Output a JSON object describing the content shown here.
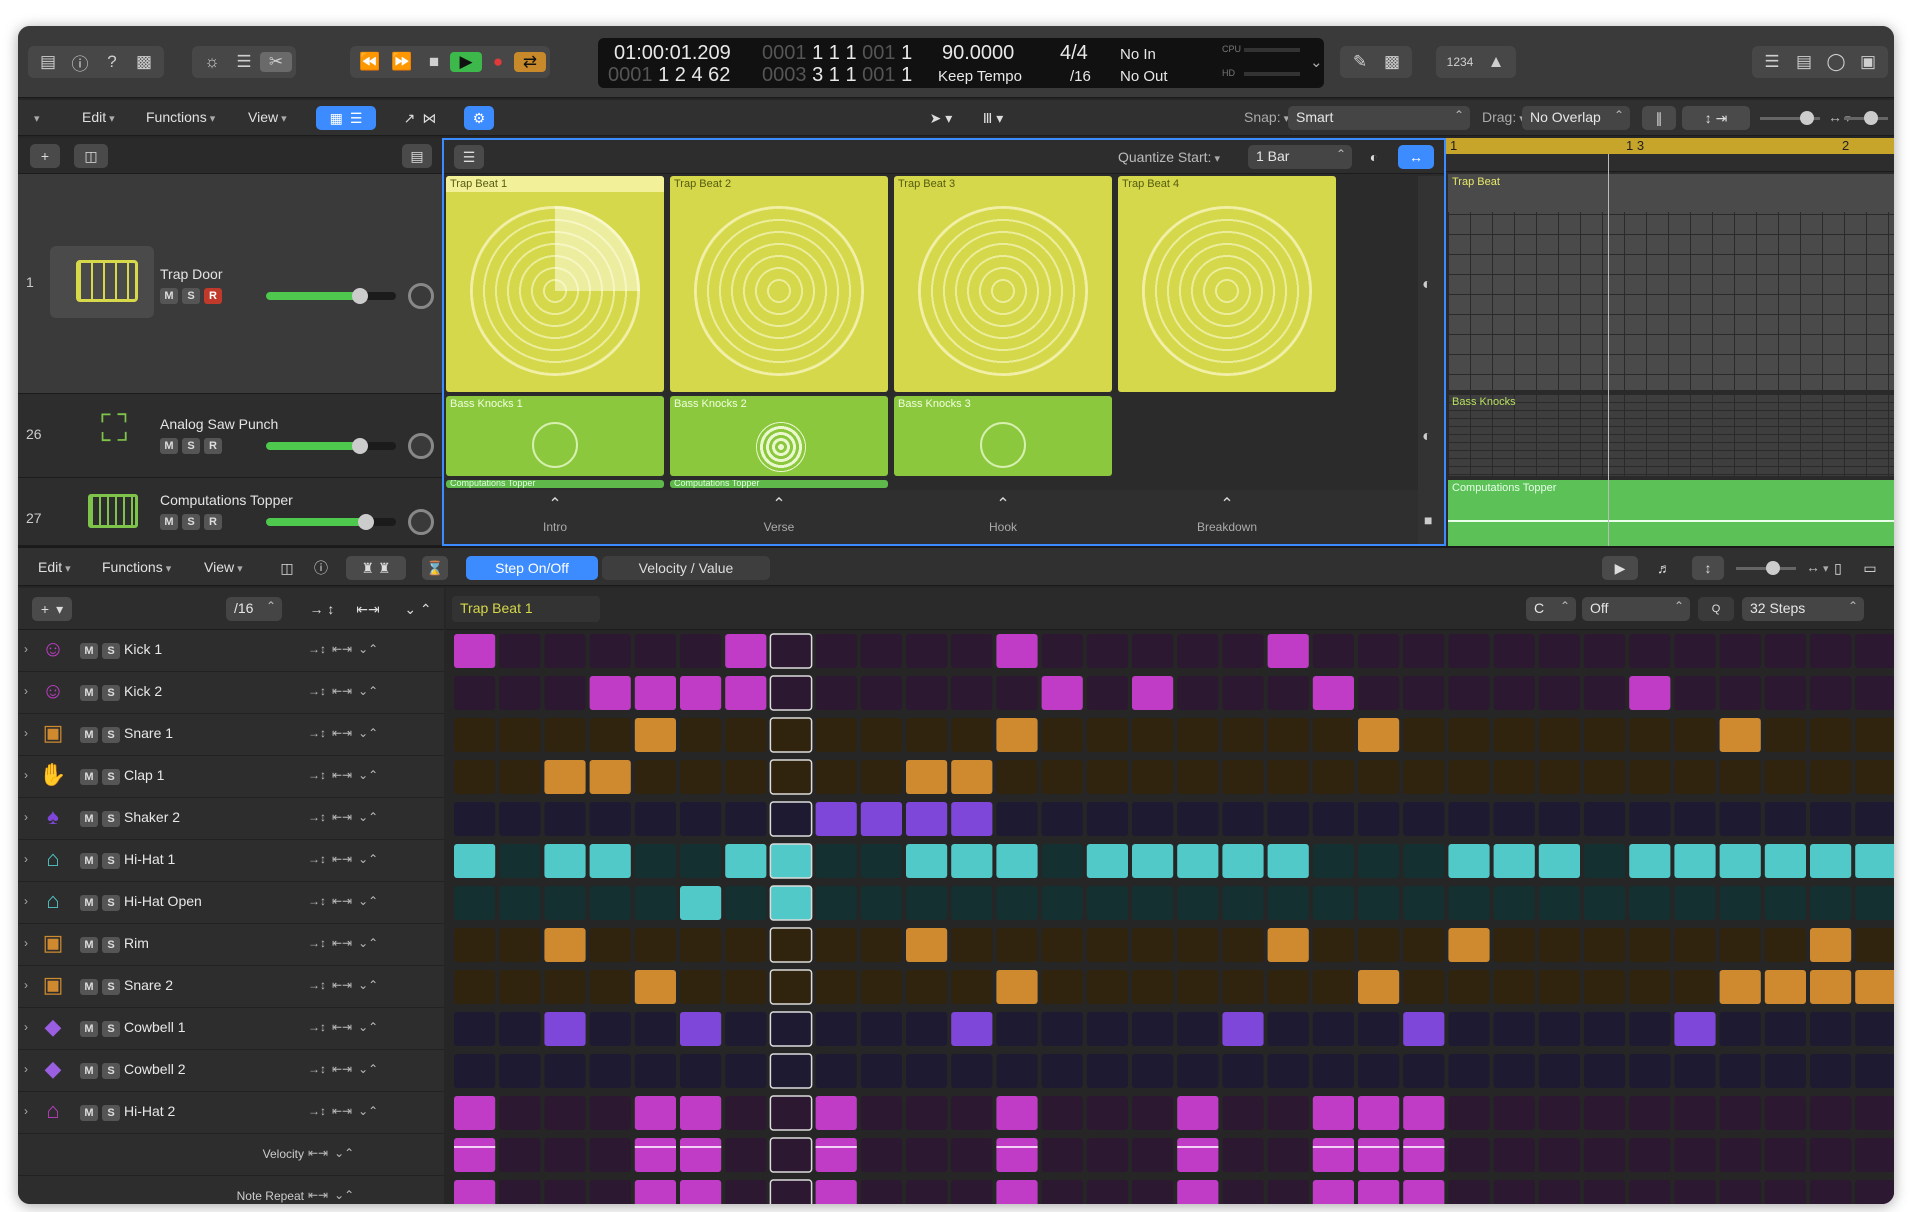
{
  "transport": {
    "timecode": "01:00:01.209",
    "bars_top": [
      "0001",
      "1",
      "1",
      "1",
      "001",
      "1"
    ],
    "bars_bottom": [
      "0001",
      "1",
      "2",
      "4",
      "62"
    ],
    "pos_top": [
      "0003",
      "1",
      "1",
      "001",
      "1"
    ],
    "pos_bottom": [
      "0003",
      "3",
      "1",
      "1",
      "001",
      "1"
    ],
    "tempo": "90.0000",
    "tempo_mode": "Keep Tempo",
    "signature": "4/4",
    "division": "/16",
    "midi_in": "No In",
    "midi_out": "No Out",
    "cpu_label": "CPU",
    "hd_label": "HD",
    "count_label": "1234"
  },
  "editbar": {
    "edit": "Edit",
    "functions": "Functions",
    "view": "View",
    "snap_label": "Snap:",
    "snap_value": "Smart",
    "drag_label": "Drag:",
    "drag_value": "No Overlap"
  },
  "grid_header": {
    "quantize_label": "Quantize Start:",
    "quantize_value": "1 Bar"
  },
  "tracks": [
    {
      "num": "1",
      "name": "Trap Door",
      "color": "#d8d94a"
    },
    {
      "num": "26",
      "name": "Analog Saw Punch",
      "color": "#7ec34a"
    },
    {
      "num": "27",
      "name": "Computations Topper",
      "color": "#7ec34a"
    }
  ],
  "cells": {
    "row1": [
      "Trap Beat 1",
      "Trap Beat 2",
      "Trap Beat 3",
      "Trap Beat 4"
    ],
    "row2": [
      "Bass Knocks 1",
      "Bass Knocks 2",
      "Bass Knocks 3"
    ],
    "row3": [
      "Computations Topper",
      "Computations Topper"
    ]
  },
  "scenes": [
    "Intro",
    "Verse",
    "Hook",
    "Breakdown"
  ],
  "timeline": {
    "ruler": [
      "1",
      "1 3",
      "2"
    ],
    "regions": [
      "Trap Beat",
      "Bass Knocks",
      "Computations Topper"
    ]
  },
  "sequencer_bar": {
    "edit": "Edit",
    "functions": "Functions",
    "view": "View",
    "mode_step": "Step On/Off",
    "mode_velocity": "Velocity / Value"
  },
  "sequencer": {
    "division": "/16",
    "pattern_name": "Trap Beat 1",
    "key": "C",
    "scale": "Off",
    "steps": "32 Steps",
    "add_symbol": "+",
    "rows": [
      {
        "name": "Kick 1",
        "icon": "☺",
        "icon_color": "#c03cc7",
        "on_color": "#c03cc7",
        "off_color": "#2c1830",
        "on": [
          0,
          6,
          12,
          18
        ]
      },
      {
        "name": "Kick 2",
        "icon": "☺",
        "icon_color": "#c03cc7",
        "on_color": "#c03cc7",
        "off_color": "#2c1830",
        "on": [
          3,
          4,
          5,
          6,
          13,
          15,
          19,
          26
        ]
      },
      {
        "name": "Snare 1",
        "icon": "▣",
        "icon_color": "#cf8a30",
        "on_color": "#cf8a30",
        "off_color": "#30240f",
        "on": [
          4,
          12,
          20,
          28
        ]
      },
      {
        "name": "Clap 1",
        "icon": "✋",
        "icon_color": "#cf8a30",
        "on_color": "#cf8a30",
        "off_color": "#30240f",
        "on": [
          2,
          3,
          10,
          11
        ]
      },
      {
        "name": "Shaker 2",
        "icon": "♠",
        "icon_color": "#7e46d9",
        "on_color": "#7e46d9",
        "off_color": "#1e1a32",
        "on": [
          8,
          9,
          10,
          11
        ]
      },
      {
        "name": "Hi-Hat 1",
        "icon": "⌂",
        "icon_color": "#52c9c9",
        "on_color": "#52c9c9",
        "off_color": "#143030",
        "on": [
          0,
          2,
          3,
          6,
          7,
          10,
          11,
          12,
          14,
          15,
          16,
          17,
          18,
          22,
          23,
          24,
          26,
          27,
          28,
          29,
          30,
          31
        ]
      },
      {
        "name": "Hi-Hat Open",
        "icon": "⌂",
        "icon_color": "#52c9c9",
        "on_color": "#52c9c9",
        "off_color": "#143030",
        "on": [
          5,
          7
        ]
      },
      {
        "name": "Rim",
        "icon": "▣",
        "icon_color": "#cf8a30",
        "on_color": "#cf8a30",
        "off_color": "#30240f",
        "on": [
          2,
          10,
          18,
          22,
          30
        ]
      },
      {
        "name": "Snare 2",
        "icon": "▣",
        "icon_color": "#cf8a30",
        "on_color": "#cf8a30",
        "off_color": "#30240f",
        "on": [
          4,
          12,
          20,
          28,
          29,
          30,
          31
        ]
      },
      {
        "name": "Cowbell 1",
        "icon": "◆",
        "icon_color": "#9a5fe0",
        "on_color": "#7e46d9",
        "off_color": "#1e1a32",
        "on": [
          2,
          5,
          11,
          17,
          21,
          27
        ]
      },
      {
        "name": "Cowbell 2",
        "icon": "◆",
        "icon_color": "#9a5fe0",
        "on_color": "#7e46d9",
        "off_color": "#1e1a32",
        "on": []
      },
      {
        "name": "Hi-Hat 2",
        "icon": "⌂",
        "icon_color": "#c03cc7",
        "on_color": "#c03cc7",
        "off_color": "#2c1830",
        "on": [
          0,
          4,
          5,
          8,
          12,
          16,
          19,
          20,
          21
        ]
      }
    ],
    "sub_rows": [
      {
        "name": "Velocity",
        "on_color": "#c03cc7",
        "off_color": "#2c1830",
        "on": [
          0,
          4,
          5,
          8,
          12,
          16,
          19,
          20,
          21
        ]
      },
      {
        "name": "Note Repeat",
        "on_color": "#c03cc7",
        "off_color": "#2c1830",
        "on": [
          0,
          4,
          5,
          8,
          12,
          16,
          19,
          20,
          21
        ]
      }
    ],
    "playhead_step": 7
  },
  "colors": {
    "accent": "#3d8cff",
    "play": "#3cb94a",
    "record": "#e23a3a",
    "cycle": "#c7892a"
  }
}
